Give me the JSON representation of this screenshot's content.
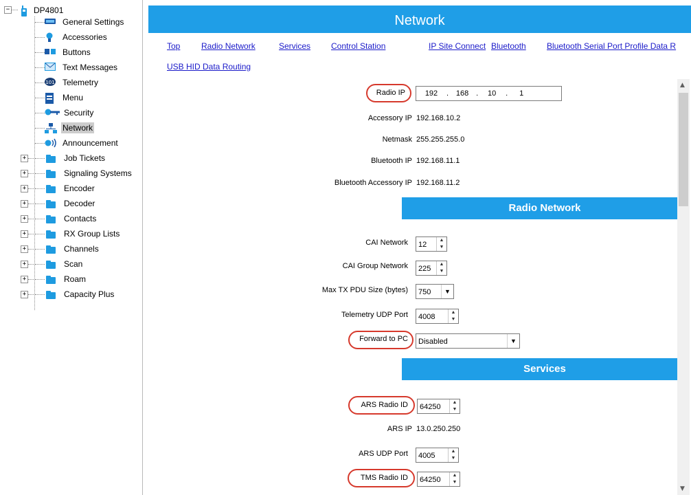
{
  "tree": {
    "root": "DP4801",
    "items": [
      {
        "label": "General Settings",
        "icon": "general-settings-icon"
      },
      {
        "label": "Accessories",
        "icon": "accessories-icon"
      },
      {
        "label": "Buttons",
        "icon": "buttons-icon"
      },
      {
        "label": "Text Messages",
        "icon": "text-messages-icon"
      },
      {
        "label": "Telemetry",
        "icon": "telemetry-icon"
      },
      {
        "label": "Menu",
        "icon": "menu-icon"
      },
      {
        "label": "Security",
        "icon": "key-icon"
      },
      {
        "label": "Network",
        "icon": "network-icon"
      },
      {
        "label": "Announcement",
        "icon": "announcement-icon"
      },
      {
        "label": "Job Tickets",
        "icon": "folder-icon"
      },
      {
        "label": "Signaling Systems",
        "icon": "folder-icon"
      },
      {
        "label": "Encoder",
        "icon": "folder-icon"
      },
      {
        "label": "Decoder",
        "icon": "folder-icon"
      },
      {
        "label": "Contacts",
        "icon": "folder-icon"
      },
      {
        "label": "RX Group Lists",
        "icon": "folder-icon"
      },
      {
        "label": "Channels",
        "icon": "folder-icon"
      },
      {
        "label": "Scan",
        "icon": "folder-icon"
      },
      {
        "label": "Roam",
        "icon": "folder-icon"
      },
      {
        "label": "Capacity Plus",
        "icon": "folder-icon"
      }
    ]
  },
  "header": {
    "title": "Network"
  },
  "links": [
    "Top",
    "Radio Network",
    "Services",
    "Control Station",
    "IP Site Connect",
    "Bluetooth",
    "Bluetooth Serial Port Profile Data R",
    "USB HID Data Routing"
  ],
  "network": {
    "radio_ip_label": "Radio IP",
    "radio_ip": [
      "192",
      "168",
      "10",
      "1"
    ],
    "accessory_ip_label": "Accessory IP",
    "accessory_ip": "192.168.10.2",
    "netmask_label": "Netmask",
    "netmask": "255.255.255.0",
    "bluetooth_ip_label": "Bluetooth IP",
    "bluetooth_ip": "192.168.11.1",
    "bluetooth_accessory_ip_label": "Bluetooth Accessory IP",
    "bluetooth_accessory_ip": "192.168.11.2"
  },
  "radio_network": {
    "title": "Radio Network",
    "cai_network_label": "CAI Network",
    "cai_network": "12",
    "cai_group_network_label": "CAI Group Network",
    "cai_group_network": "225",
    "max_tx_pdu_label": "Max TX PDU Size (bytes)",
    "max_tx_pdu": "750",
    "telemetry_udp_port_label": "Telemetry UDP Port",
    "telemetry_udp_port": "4008",
    "forward_to_pc_label": "Forward to PC",
    "forward_to_pc": "Disabled"
  },
  "services": {
    "title": "Services",
    "ars_radio_id_label": "ARS Radio ID",
    "ars_radio_id": "64250",
    "ars_ip_label": "ARS IP",
    "ars_ip": "13.0.250.250",
    "ars_udp_port_label": "ARS UDP Port",
    "ars_udp_port": "4005",
    "tms_radio_id_label": "TMS Radio ID",
    "tms_radio_id": "64250"
  },
  "colors": {
    "accent": "#1f9ee7",
    "highlight": "#d6392c",
    "link": "#1a1ac9"
  }
}
